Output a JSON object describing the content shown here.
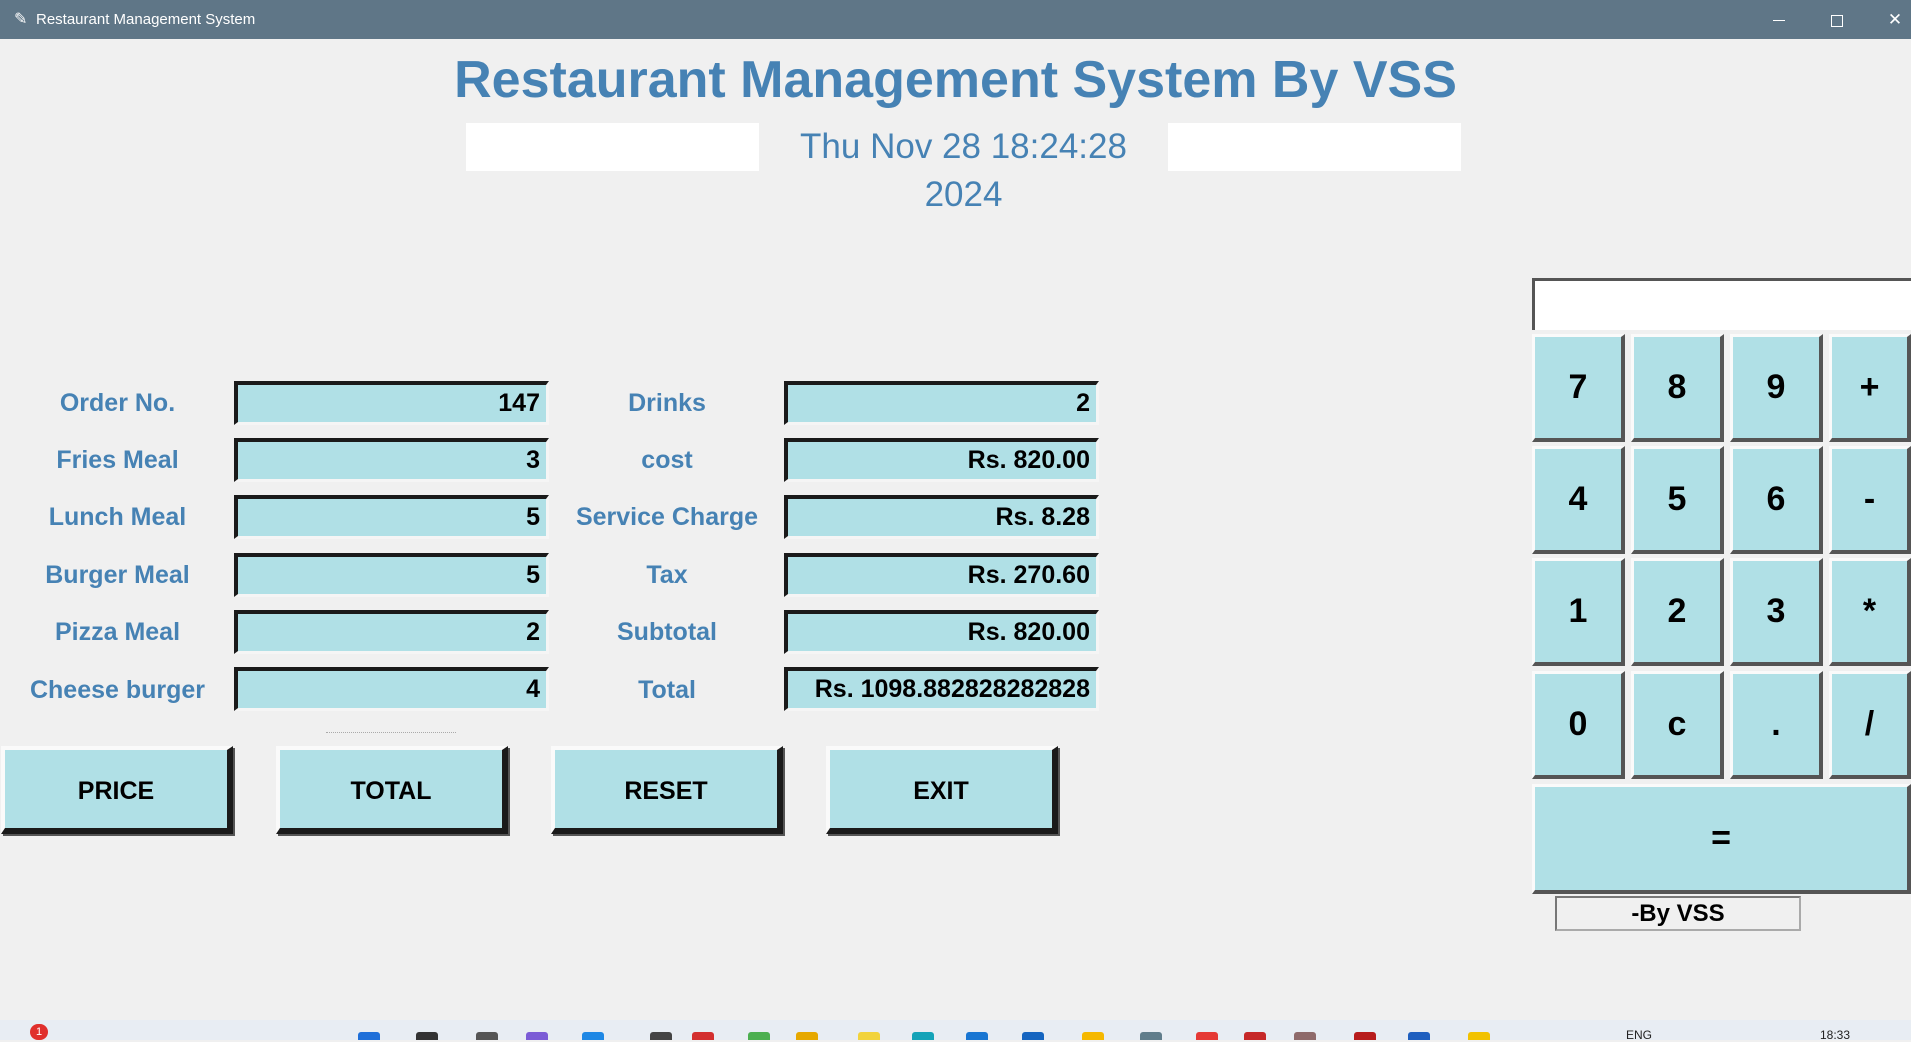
{
  "window": {
    "title": "Restaurant Management System",
    "controls": [
      "minimize-icon",
      "maximize-icon",
      "close-icon"
    ]
  },
  "header": {
    "title": "Restaurant Management System By VSS",
    "datetime": "Thu Nov 28 18:24:28 2024"
  },
  "left_fields": [
    {
      "label": "Order No.",
      "value": "147"
    },
    {
      "label": "Fries Meal",
      "value": "3"
    },
    {
      "label": "Lunch Meal",
      "value": "5"
    },
    {
      "label": "Burger Meal",
      "value": "5"
    },
    {
      "label": "Pizza Meal",
      "value": "2"
    },
    {
      "label": "Cheese burger",
      "value": "4"
    }
  ],
  "right_fields": [
    {
      "label": "Drinks",
      "value": "2"
    },
    {
      "label": "cost",
      "value": "Rs. 820.00"
    },
    {
      "label": "Service Charge",
      "value": "Rs. 8.28"
    },
    {
      "label": "Tax",
      "value": "Rs. 270.60"
    },
    {
      "label": "Subtotal",
      "value": "Rs. 820.00"
    },
    {
      "label": "Total",
      "value": "Rs. 1098.882828282828"
    }
  ],
  "buttons": {
    "price": "PRICE",
    "total": "TOTAL",
    "reset": "RESET",
    "exit": "EXIT"
  },
  "calculator": {
    "display": "",
    "keys": [
      "7",
      "8",
      "9",
      "+",
      "4",
      "5",
      "6",
      "-",
      "1",
      "2",
      "3",
      "*",
      "0",
      "c",
      ".",
      "/"
    ],
    "equals": "=",
    "credit": "-By VSS"
  },
  "taskbar": {
    "notification_count": "1",
    "language": "ENG",
    "time": "18:33"
  },
  "colors": {
    "accent": "#4682b4",
    "field_bg": "#b0e0e6",
    "titlebar": "#5f7687",
    "background": "#f0f0f0"
  }
}
